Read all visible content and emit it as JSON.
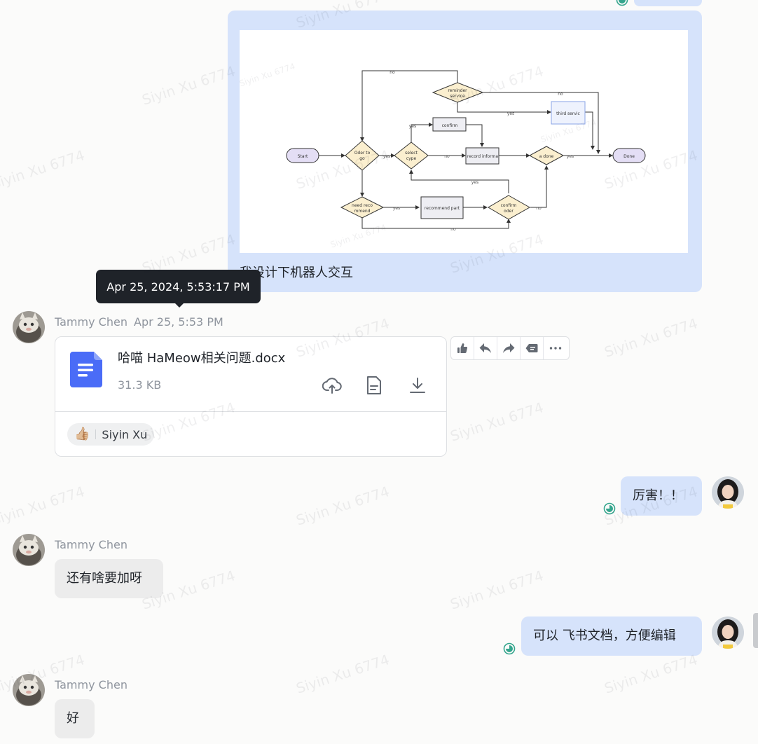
{
  "top_message": {
    "caption": "我设计下机器人交互",
    "flowchart": {
      "nodes": {
        "start": "Start",
        "order_to_go": [
          "Oder to",
          "go"
        ],
        "reminder": [
          "reminder",
          "service"
        ],
        "third": "third servic",
        "confirm": "confirm",
        "select": [
          "select",
          "cype"
        ],
        "record": "record informa",
        "done_q": "a done",
        "done": "Done",
        "need": [
          "need reco",
          "mmend"
        ],
        "recommend": "recommend part",
        "confirm_order": [
          "confirm",
          "oder"
        ]
      },
      "edge_labels": {
        "no": "no",
        "yes": "yes"
      }
    }
  },
  "tooltip": {
    "text": "Apr 25, 2024, 5:53:17 PM"
  },
  "file_message": {
    "sender": "Tammy Chen",
    "time": "Apr 25, 5:53 PM",
    "file_name": "哈喵 HaMeow相关问题.docx",
    "file_size": "31.3 KB",
    "reaction_user": "Siyin Xu",
    "reaction_emoji": "👍🏼"
  },
  "messages": {
    "me_1": "厉害！！",
    "them_1_sender": "Tammy Chen",
    "them_1": "还有啥要加呀",
    "me_2": "可以 飞书文档，方便编辑",
    "them_2_sender": "Tammy Chen",
    "them_2": "好"
  },
  "watermark": "Siyin Xu 6774",
  "colors": {
    "my_bubble": "#d6e3fb",
    "their_bubble": "#ececec",
    "read_green": "#34a58d",
    "doc_blue": "#4a6cf7"
  }
}
